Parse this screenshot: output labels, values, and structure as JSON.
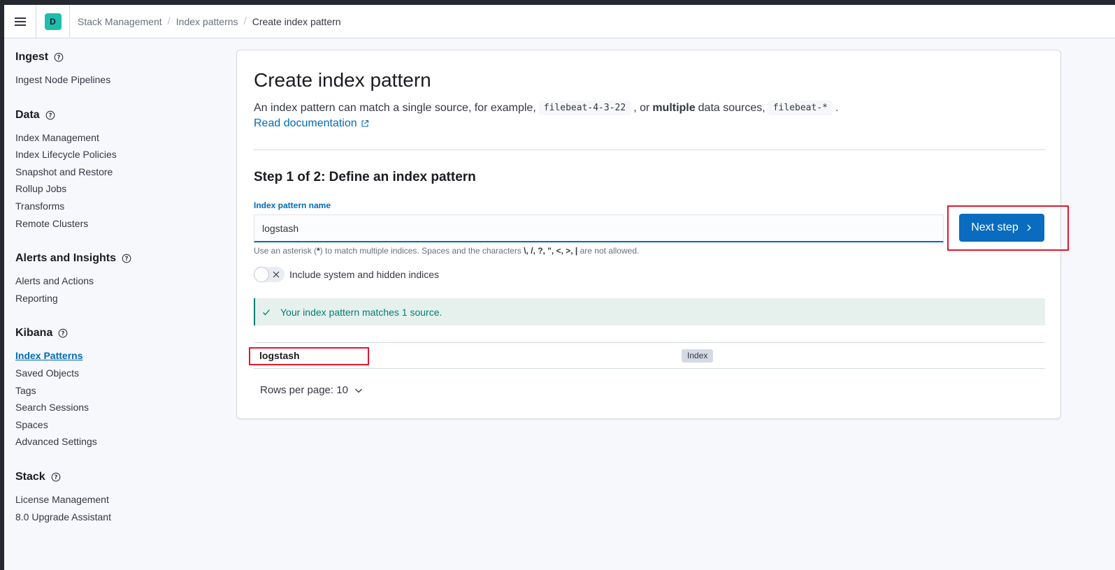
{
  "header": {
    "space_initial": "D",
    "breadcrumbs": [
      "Stack Management",
      "Index patterns",
      "Create index pattern"
    ]
  },
  "sidebar": {
    "groups": [
      {
        "title": "Ingest",
        "items": [
          "Ingest Node Pipelines"
        ]
      },
      {
        "title": "Data",
        "items": [
          "Index Management",
          "Index Lifecycle Policies",
          "Snapshot and Restore",
          "Rollup Jobs",
          "Transforms",
          "Remote Clusters"
        ]
      },
      {
        "title": "Alerts and Insights",
        "items": [
          "Alerts and Actions",
          "Reporting"
        ]
      },
      {
        "title": "Kibana",
        "items": [
          "Index Patterns",
          "Saved Objects",
          "Tags",
          "Search Sessions",
          "Spaces",
          "Advanced Settings"
        ]
      },
      {
        "title": "Stack",
        "items": [
          "License Management",
          "8.0 Upgrade Assistant"
        ]
      }
    ],
    "active_item": "Index Patterns"
  },
  "main": {
    "title": "Create index pattern",
    "desc_prefix": "An index pattern can match a single source, for example,",
    "desc_code1": "filebeat-4-3-22",
    "desc_mid": ", or",
    "desc_bold": "multiple",
    "desc_suffix": "data sources,",
    "desc_code2": "filebeat-*",
    "desc_end": ".",
    "read_doc": "Read documentation",
    "step_title": "Step 1 of 2: Define an index pattern",
    "field_label": "Index pattern name",
    "input_value": "logstash",
    "help_prefix": "Use an asterisk (",
    "help_star": "*",
    "help_mid": ") to match multiple indices. Spaces and the characters",
    "help_chars": "\\, /, ?, \", <, >, |",
    "help_suffix": "are not allowed.",
    "next_label": "Next step",
    "toggle_label": "Include system and hidden indices",
    "toggle_on": false,
    "callout": "Your index pattern matches 1 source.",
    "rows": [
      {
        "name": "logstash",
        "badge": "Index"
      }
    ],
    "rows_per_page": "Rows per page: 10"
  },
  "colors": {
    "primary": "#0a6cbf",
    "success": "#017d73",
    "highlight": "#e0182d",
    "space_badge": "#1ebeae"
  },
  "icons": [
    "menu-icon",
    "help-icon",
    "external-link-icon",
    "chevron-right-icon",
    "cross-icon",
    "check-icon",
    "chevron-down-icon"
  ]
}
